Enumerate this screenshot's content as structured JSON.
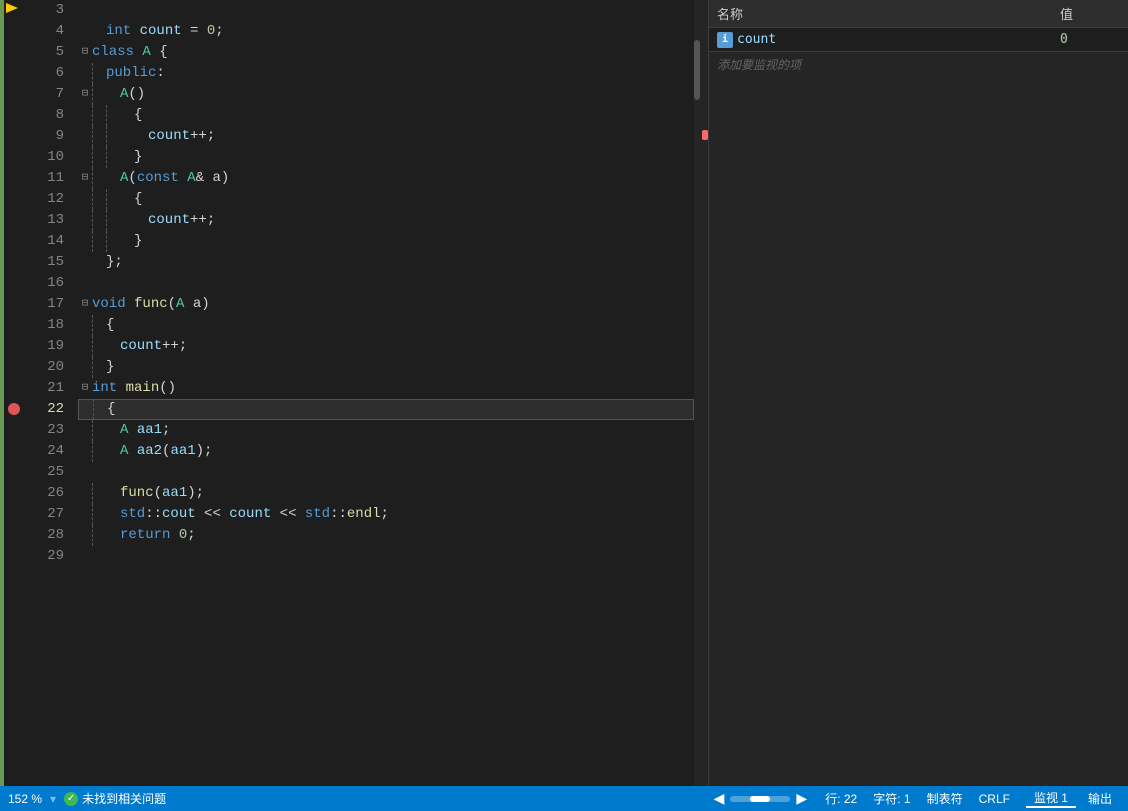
{
  "editor": {
    "lines": [
      {
        "num": 3,
        "content": [],
        "raw": ""
      },
      {
        "num": 4,
        "content": [
          {
            "t": "indent",
            "v": "    "
          },
          {
            "t": "kw",
            "v": "int"
          },
          {
            "t": "op",
            "v": " "
          },
          {
            "t": "var",
            "v": "count"
          },
          {
            "t": "op",
            "v": " = "
          },
          {
            "t": "num",
            "v": "0"
          },
          {
            "t": "op",
            "v": ";"
          }
        ],
        "raw": "    int count = 0;"
      },
      {
        "num": 5,
        "content": [
          {
            "t": "collapse",
            "v": "⊟"
          },
          {
            "t": "kw",
            "v": "class"
          },
          {
            "t": "op",
            "v": " "
          },
          {
            "t": "type",
            "v": "A"
          },
          {
            "t": "op",
            "v": " {"
          }
        ],
        "raw": "class A {"
      },
      {
        "num": 6,
        "content": [
          {
            "t": "indent",
            "v": "  "
          },
          {
            "t": "kw",
            "v": "public"
          },
          {
            "t": "op",
            "v": ":"
          }
        ],
        "raw": "  public:"
      },
      {
        "num": 7,
        "content": [
          {
            "t": "collapse",
            "v": "⊟"
          },
          {
            "t": "indent4",
            "v": "    "
          },
          {
            "t": "type",
            "v": "A"
          },
          {
            "t": "op",
            "v": "()"
          }
        ],
        "raw": "    A()"
      },
      {
        "num": 8,
        "content": [
          {
            "t": "indent4",
            "v": "    "
          },
          {
            "t": "op",
            "v": "{"
          }
        ],
        "raw": "    {"
      },
      {
        "num": 9,
        "content": [
          {
            "t": "indent8",
            "v": "        "
          },
          {
            "t": "var",
            "v": "count"
          },
          {
            "t": "op",
            "v": "++;"
          }
        ],
        "raw": "        count++;"
      },
      {
        "num": 10,
        "content": [
          {
            "t": "indent4",
            "v": "    "
          },
          {
            "t": "op",
            "v": "}"
          }
        ],
        "raw": "    }"
      },
      {
        "num": 11,
        "content": [
          {
            "t": "collapse",
            "v": "⊟"
          },
          {
            "t": "indent4",
            "v": "    "
          },
          {
            "t": "type",
            "v": "A"
          },
          {
            "t": "op",
            "v": "("
          },
          {
            "t": "kw",
            "v": "const"
          },
          {
            "t": "op",
            "v": " "
          },
          {
            "t": "type",
            "v": "A"
          },
          {
            "t": "op",
            "v": "& a)"
          }
        ],
        "raw": "    A(const A& a)"
      },
      {
        "num": 12,
        "content": [
          {
            "t": "indent4",
            "v": "    "
          },
          {
            "t": "op",
            "v": "{"
          }
        ],
        "raw": "    {"
      },
      {
        "num": 13,
        "content": [
          {
            "t": "indent8",
            "v": "        "
          },
          {
            "t": "var",
            "v": "count"
          },
          {
            "t": "op",
            "v": "++;"
          }
        ],
        "raw": "        count++;"
      },
      {
        "num": 14,
        "content": [
          {
            "t": "indent4",
            "v": "    "
          },
          {
            "t": "op",
            "v": "}"
          }
        ],
        "raw": "    }"
      },
      {
        "num": 15,
        "content": [
          {
            "t": "op",
            "v": "};"
          }
        ],
        "raw": "};"
      },
      {
        "num": 16,
        "content": [],
        "raw": ""
      },
      {
        "num": 17,
        "content": [
          {
            "t": "collapse",
            "v": "⊟"
          },
          {
            "t": "kw",
            "v": "void"
          },
          {
            "t": "op",
            "v": " "
          },
          {
            "t": "fn",
            "v": "func"
          },
          {
            "t": "op",
            "v": "("
          },
          {
            "t": "type",
            "v": "A"
          },
          {
            "t": "op",
            "v": " a)"
          }
        ],
        "raw": "void func(A a)"
      },
      {
        "num": 18,
        "content": [
          {
            "t": "op",
            "v": "{"
          }
        ],
        "raw": "{"
      },
      {
        "num": 19,
        "content": [
          {
            "t": "indent4",
            "v": "    "
          },
          {
            "t": "var",
            "v": "count"
          },
          {
            "t": "op",
            "v": "++;"
          }
        ],
        "raw": "    count++;"
      },
      {
        "num": 20,
        "content": [
          {
            "t": "op",
            "v": "}"
          }
        ],
        "raw": "}"
      },
      {
        "num": 21,
        "content": [
          {
            "t": "collapse",
            "v": "⊟"
          },
          {
            "t": "kw",
            "v": "int"
          },
          {
            "t": "op",
            "v": " "
          },
          {
            "t": "fn",
            "v": "main"
          },
          {
            "t": "op",
            "v": "()"
          }
        ],
        "raw": "int main()"
      },
      {
        "num": 22,
        "content": [
          {
            "t": "op",
            "v": "{"
          }
        ],
        "raw": "{",
        "highlighted": true
      },
      {
        "num": 23,
        "content": [
          {
            "t": "indent4",
            "v": "    "
          },
          {
            "t": "type",
            "v": "A"
          },
          {
            "t": "op",
            "v": " "
          },
          {
            "t": "var",
            "v": "aa1"
          },
          {
            "t": "op",
            "v": ";"
          }
        ],
        "raw": "    A aa1;"
      },
      {
        "num": 24,
        "content": [
          {
            "t": "indent4",
            "v": "    "
          },
          {
            "t": "type",
            "v": "A"
          },
          {
            "t": "op",
            "v": " "
          },
          {
            "t": "var",
            "v": "aa2"
          },
          {
            "t": "op",
            "v": "("
          },
          {
            "t": "var",
            "v": "aa1"
          },
          {
            "t": "op",
            "v": ");"
          }
        ],
        "raw": "    A aa2(aa1);"
      },
      {
        "num": 25,
        "content": [],
        "raw": ""
      },
      {
        "num": 26,
        "content": [
          {
            "t": "indent4",
            "v": "    "
          },
          {
            "t": "fn",
            "v": "func"
          },
          {
            "t": "op",
            "v": "("
          },
          {
            "t": "var",
            "v": "aa1"
          },
          {
            "t": "op",
            "v": ");"
          }
        ],
        "raw": "    func(aa1);"
      },
      {
        "num": 27,
        "content": [
          {
            "t": "indent4",
            "v": "    "
          },
          {
            "t": "kw",
            "v": "std"
          },
          {
            "t": "op",
            "v": "::"
          },
          {
            "t": "var",
            "v": "cout"
          },
          {
            "t": "op",
            "v": " << "
          },
          {
            "t": "var",
            "v": "count"
          },
          {
            "t": "op",
            "v": " << "
          },
          {
            "t": "kw",
            "v": "std"
          },
          {
            "t": "op",
            "v": "::"
          },
          {
            "t": "fn",
            "v": "endl"
          },
          {
            "t": "op",
            "v": ";"
          }
        ],
        "raw": "    std::cout << count << std::endl;"
      },
      {
        "num": 28,
        "content": [
          {
            "t": "indent4",
            "v": "    "
          },
          {
            "t": "kw",
            "v": "return"
          },
          {
            "t": "op",
            "v": " "
          },
          {
            "t": "num",
            "v": "0"
          },
          {
            "t": "op",
            "v": ";"
          }
        ],
        "raw": "    return 0;"
      },
      {
        "num": 29,
        "content": [],
        "raw": ""
      }
    ]
  },
  "watch_panel": {
    "col_name": "名称",
    "col_value": "值",
    "items": [
      {
        "name": "count",
        "value": "0",
        "icon": "i"
      }
    ],
    "add_hint": "添加要监视的项"
  },
  "status_bar": {
    "zoom": "152 %",
    "issue_icon": "✓",
    "issue_text": "未找到相关问题",
    "row_label": "行:",
    "row_value": "22",
    "char_label": "字符:",
    "char_value": "1",
    "tab_label": "制表符",
    "eol": "CRLF",
    "tabs": [
      {
        "label": "监视 1",
        "active": true
      },
      {
        "label": "输出",
        "active": false
      }
    ]
  },
  "breakpoint": {
    "line": 22,
    "icon": "●"
  }
}
